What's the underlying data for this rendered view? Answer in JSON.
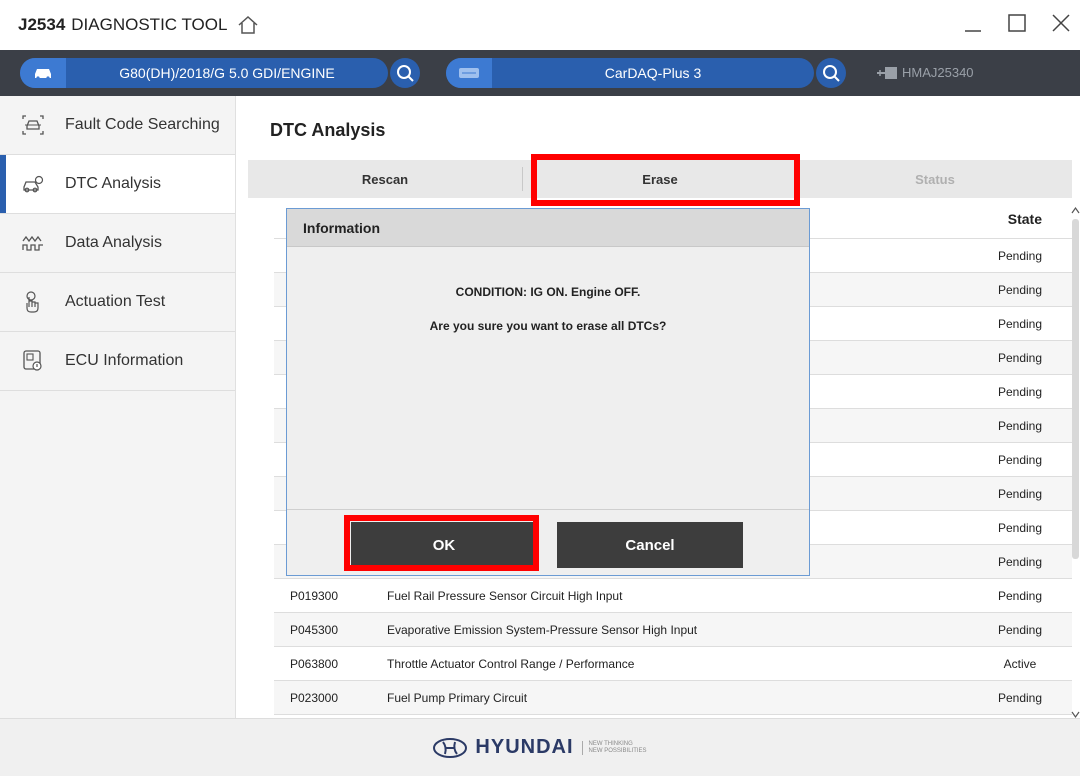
{
  "app": {
    "title_bold": "J2534",
    "title_rest": "DIAGNOSTIC TOOL"
  },
  "devicebar": {
    "vehicle": "G80(DH)/2018/G 5.0 GDI/ENGINE",
    "interface": "CarDAQ-Plus 3",
    "serial": "HMAJ25340"
  },
  "sidebar": {
    "items": [
      {
        "label": "Fault Code Searching",
        "icon": "car-scan-icon"
      },
      {
        "label": "DTC Analysis",
        "icon": "car-wrench-icon"
      },
      {
        "label": "Data Analysis",
        "icon": "waveform-icon"
      },
      {
        "label": "Actuation Test",
        "icon": "hand-touch-icon"
      },
      {
        "label": "ECU Information",
        "icon": "ecu-chip-icon"
      }
    ],
    "active": "DTC Analysis"
  },
  "main": {
    "title": "DTC Analysis",
    "tabs": [
      "Rescan",
      "Erase",
      "Status"
    ],
    "table_header_state": "State",
    "rows": [
      {
        "code": "",
        "desc": "",
        "state": "Pending"
      },
      {
        "code": "",
        "desc": "",
        "state": "Pending"
      },
      {
        "code": "",
        "desc": "",
        "state": "Pending"
      },
      {
        "code": "",
        "desc": "",
        "state": "Pending"
      },
      {
        "code": "",
        "desc": "",
        "state": "Pending"
      },
      {
        "code": "",
        "desc": "",
        "state": "Pending"
      },
      {
        "code": "",
        "desc": "",
        "state": "Pending"
      },
      {
        "code": "",
        "desc": "",
        "state": "Pending"
      },
      {
        "code": "",
        "desc": "",
        "state": "Pending"
      },
      {
        "code": "",
        "desc": "",
        "state": "Pending"
      },
      {
        "code": "P019300",
        "desc": "Fuel Rail Pressure Sensor Circuit High Input",
        "state": "Pending"
      },
      {
        "code": "P045300",
        "desc": "Evaporative Emission System-Pressure Sensor High Input",
        "state": "Pending"
      },
      {
        "code": "P063800",
        "desc": "Throttle Actuator Control Range / Performance",
        "state": "Active"
      },
      {
        "code": "P023000",
        "desc": "Fuel Pump Primary Circuit",
        "state": "Pending"
      }
    ]
  },
  "dialog": {
    "title": "Information",
    "line1": "CONDITION: IG ON. Engine OFF.",
    "line2": "Are you sure you want to erase all DTCs?",
    "ok": "OK",
    "cancel": "Cancel"
  },
  "footer": {
    "brand": "HYUNDAI",
    "tagline_1": "NEW THINKING",
    "tagline_2": "NEW POSSIBILITIES"
  },
  "colors": {
    "accent": "#2a5fae",
    "highlight": "#ff0000",
    "bar": "#3b3f47"
  }
}
